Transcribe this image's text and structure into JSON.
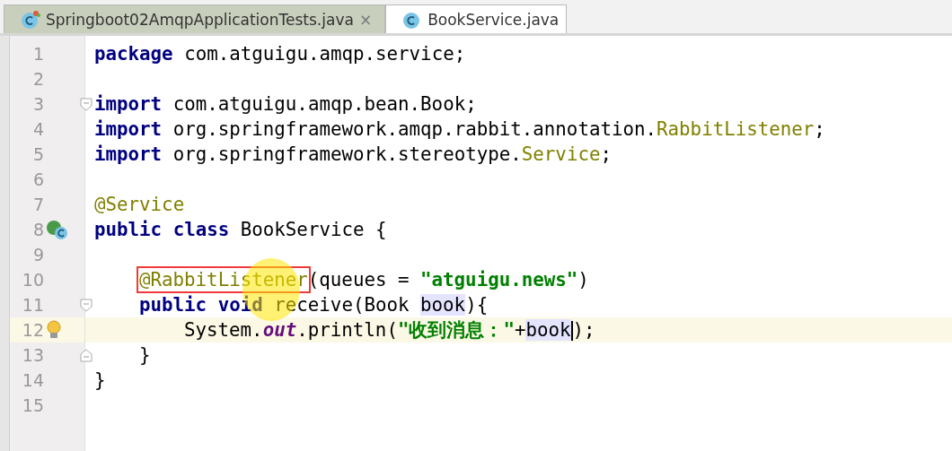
{
  "tabs": [
    {
      "label": "Springboot02AmqpApplicationTests.java",
      "selected": false,
      "close_label": "×"
    },
    {
      "label": "BookService.java",
      "selected": true
    }
  ],
  "lines": [
    {
      "number": "1",
      "current": false,
      "tokens": [
        {
          "kind": "kw",
          "text": "package"
        },
        {
          "kind": "plain",
          "text": " com.atguigu.amqp.service;"
        }
      ]
    },
    {
      "number": "2",
      "current": false
    },
    {
      "number": "3",
      "current": false,
      "fold": {
        "kind": "start"
      },
      "tokens": [
        {
          "kind": "kw",
          "text": "import"
        },
        {
          "kind": "plain",
          "text": " com.atguigu.amqp.bean.Book;"
        }
      ]
    },
    {
      "number": "4",
      "current": false,
      "tokens": [
        {
          "kind": "kw",
          "text": "import"
        },
        {
          "kind": "plain",
          "text": " org.springframework.amqp.rabbit.annotation."
        },
        {
          "kind": "anno",
          "text": "RabbitListener"
        },
        {
          "kind": "plain",
          "text": ";"
        }
      ]
    },
    {
      "number": "5",
      "current": false,
      "tokens": [
        {
          "kind": "kw",
          "text": "import"
        },
        {
          "kind": "plain",
          "text": " org.springframework.stereotype."
        },
        {
          "kind": "anno",
          "text": "Service"
        },
        {
          "kind": "plain",
          "text": ";"
        }
      ]
    },
    {
      "number": "6",
      "current": false
    },
    {
      "number": "7",
      "current": false,
      "tokens": [
        {
          "kind": "anno",
          "text": "@Service"
        }
      ]
    },
    {
      "number": "8",
      "current": false,
      "marker": {
        "kind": "class"
      },
      "tokens": [
        {
          "kind": "kw",
          "text": "public class"
        },
        {
          "kind": "plain",
          "text": " BookService {"
        }
      ]
    },
    {
      "number": "9",
      "current": false
    },
    {
      "number": "10",
      "current": false,
      "indent": {
        "kind": "class"
      },
      "tokens": [
        {
          "kind": "anno",
          "text": "@RabbitListener",
          "boxed": true
        },
        {
          "kind": "plain",
          "text": "(queues = "
        },
        {
          "kind": "str",
          "text": "\"atguigu.news\""
        },
        {
          "kind": "plain",
          "text": ")"
        }
      ]
    },
    {
      "number": "11",
      "current": false,
      "indent": {
        "kind": "class"
      },
      "fold": {
        "kind": "start"
      },
      "tokens": [
        {
          "kind": "kw",
          "text": "public void"
        },
        {
          "kind": "plain",
          "text": " receive(Book "
        },
        {
          "kind": "ref",
          "text": "book"
        },
        {
          "kind": "plain",
          "text": "){"
        }
      ]
    },
    {
      "number": "12",
      "current": true,
      "indent": {
        "kind": "method"
      },
      "marker": {
        "kind": "bulb"
      },
      "tokens": [
        {
          "kind": "plain",
          "text": "System."
        },
        {
          "kind": "static",
          "text": "out"
        },
        {
          "kind": "plain",
          "text": ".println("
        },
        {
          "kind": "str",
          "text": "\"收到消息：\""
        },
        {
          "kind": "plain",
          "text": "+"
        },
        {
          "kind": "ref",
          "text": "book",
          "caret": true
        },
        {
          "kind": "plain",
          "text": ");"
        }
      ]
    },
    {
      "number": "13",
      "current": false,
      "indent": {
        "kind": "class"
      },
      "fold": {
        "kind": "end"
      },
      "tokens": [
        {
          "kind": "plain",
          "text": "}"
        }
      ]
    },
    {
      "number": "14",
      "current": false,
      "tokens": [
        {
          "kind": "plain",
          "text": "}"
        }
      ]
    },
    {
      "number": "15",
      "current": false
    }
  ]
}
